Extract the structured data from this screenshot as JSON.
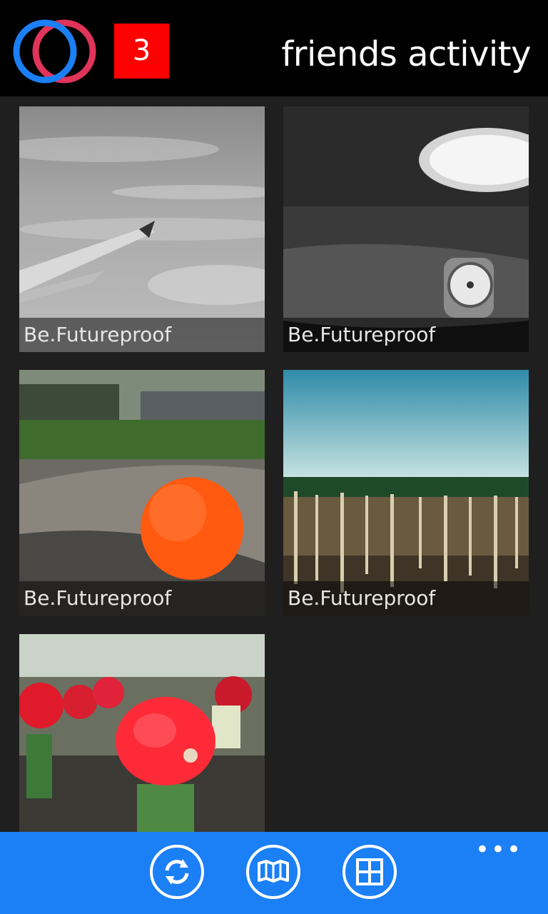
{
  "header": {
    "title": "friends activity",
    "notification_count": "3",
    "colors": {
      "ring_blue": "#1b7ff5",
      "ring_pink": "#e0345a",
      "badge": "#ff0000"
    }
  },
  "tiles": [
    {
      "caption": "Be.Futureproof",
      "image": "airplane-wing-photo"
    },
    {
      "caption": "Be.Futureproof",
      "image": "wristwatch-photo"
    },
    {
      "caption": "Be.Futureproof",
      "image": "orange-golf-ball-photo"
    },
    {
      "caption": "Be.Futureproof",
      "image": "field-stakes-photo"
    },
    {
      "caption": "",
      "image": "red-cactus-photo"
    }
  ],
  "appbar": {
    "buttons": [
      {
        "icon": "refresh-icon"
      },
      {
        "icon": "map-icon"
      },
      {
        "icon": "tiles-grid-icon"
      }
    ],
    "more": "•••",
    "color": "#1b7ff5"
  }
}
